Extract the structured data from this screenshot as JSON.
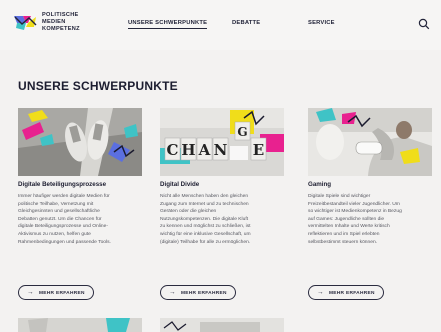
{
  "logo": {
    "lines": [
      "POLITISCHE",
      "MEDIEN",
      "KOMPETENZ"
    ]
  },
  "nav": {
    "items": [
      "UNSERE SCHWERPUNKTE",
      "DEBATTE",
      "SERVICE"
    ],
    "active": "UNSERE SCHWERPUNKTE"
  },
  "icons": {
    "search": "search-icon",
    "more": "arrow-right-icon"
  },
  "colors": {
    "background": "#f3f2f1",
    "text": "#1c1d30",
    "accent_blue": "#5b6fe0",
    "accent_pink": "#e8218f",
    "accent_yellow": "#f0dd1a",
    "accent_teal": "#3fc3c6"
  },
  "main": {
    "title": "UNSERE SCHWERPUNKTE",
    "cards": [
      {
        "title": "Digitale Beteiligungsprozesse",
        "body": [
          "Immer häufiger werden digitale Medien für",
          "politische Teilhabe, Vernetzung mit",
          "Gleichgesinnten und gesellschaftliche",
          "Debatten genutzt. Um die Chancen für",
          "digitale Beteiligungsprozesse und Online-",
          "Aktivismus zu nutzen, helfen gute",
          "Rahmenbedingungen und passende Tools."
        ],
        "button": "MEHR ERFAHREN",
        "image_text": ""
      },
      {
        "title": "Digital Divide",
        "body": [
          "Nicht alle Menschen haben den gleichen",
          "Zugang zum Internet und zu technischen",
          "Geräten oder die gleichen",
          "Nutzungskompetenzen. Die digitale Kluft",
          "zu kennen und möglichst zu schließen, ist",
          "wichtig für eine inklusive Gesellschaft, um",
          "(digitale) Teilhabe für alle zu ermöglichen."
        ],
        "button": "MEHR ERFAHREN",
        "image_text": "CHANCE"
      },
      {
        "title": "Gaming",
        "body": [
          "Digitale Spiele sind wichtiger",
          "Freizeitbestandteil vieler Jugendlicher. Um",
          "so wichtiger ist Medienkompetenz in Bezug",
          "auf Games: Jugendliche sollten die",
          "vermittelten Inhalte und Werte kritisch",
          "reflektieren und im Spiel erlebten",
          "selbstbestimmt steuern können."
        ],
        "button": "MEHR ERFAHREN",
        "image_text": ""
      }
    ]
  }
}
